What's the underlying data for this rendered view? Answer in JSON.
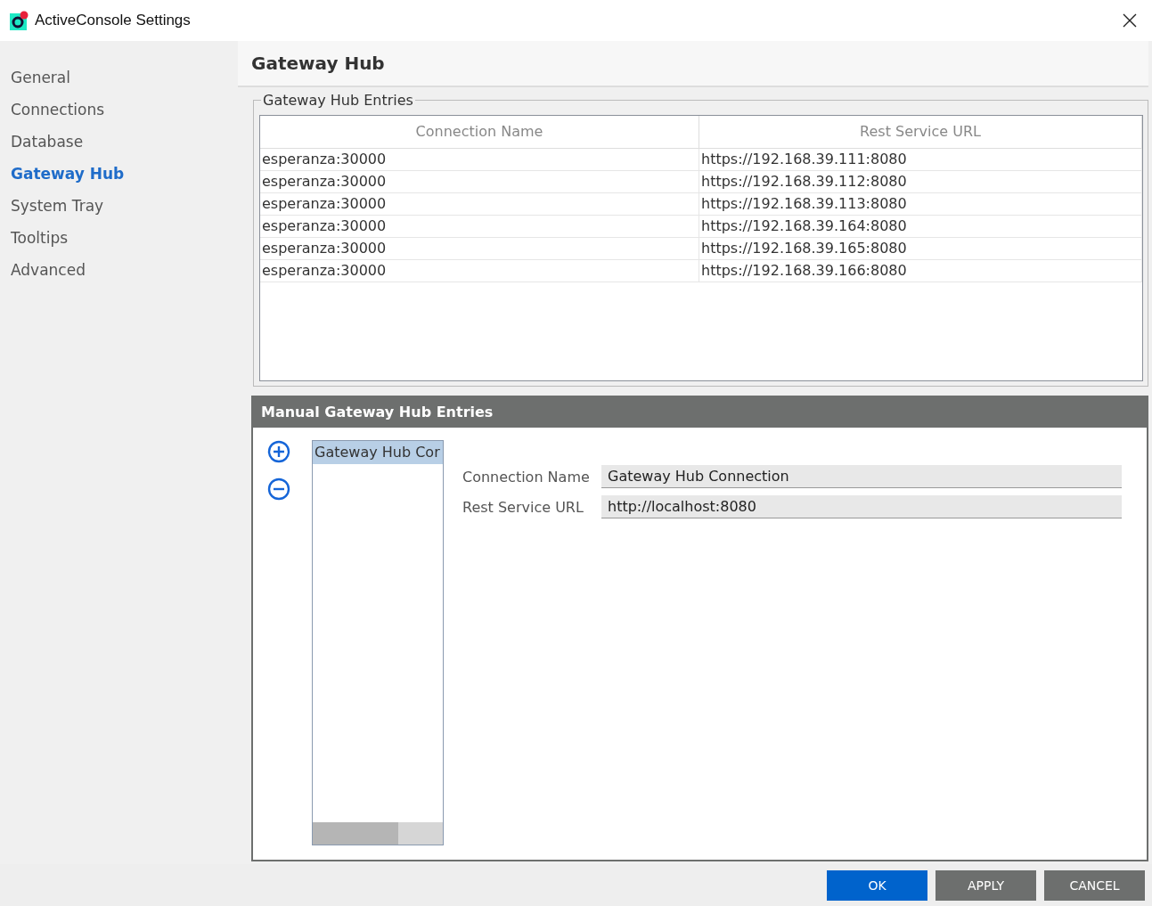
{
  "window": {
    "title": "ActiveConsole Settings"
  },
  "sidebar": {
    "items": [
      {
        "label": "General",
        "selected": false
      },
      {
        "label": "Connections",
        "selected": false
      },
      {
        "label": "Database",
        "selected": false
      },
      {
        "label": "Gateway Hub",
        "selected": true
      },
      {
        "label": "System Tray",
        "selected": false
      },
      {
        "label": "Tooltips",
        "selected": false
      },
      {
        "label": "Advanced",
        "selected": false
      }
    ]
  },
  "page_title": "Gateway Hub",
  "entries": {
    "title": "Gateway Hub Entries",
    "columns": [
      "Connection Name",
      "Rest Service URL"
    ],
    "rows": [
      [
        "esperanza:30000",
        "https://192.168.39.111:8080"
      ],
      [
        "esperanza:30000",
        "https://192.168.39.112:8080"
      ],
      [
        "esperanza:30000",
        "https://192.168.39.113:8080"
      ],
      [
        "esperanza:30000",
        "https://192.168.39.164:8080"
      ],
      [
        "esperanza:30000",
        "https://192.168.39.165:8080"
      ],
      [
        "esperanza:30000",
        "https://192.168.39.166:8080"
      ]
    ]
  },
  "manual": {
    "title": "Manual Gateway Hub Entries",
    "list": [
      {
        "label": "Gateway Hub Cor",
        "selected": true
      }
    ],
    "fields": [
      {
        "label": "Connection Name",
        "value": "Gateway Hub Connection"
      },
      {
        "label": "Rest Service URL",
        "value": "http://localhost:8080"
      }
    ]
  },
  "buttons": [
    {
      "label": "OK",
      "kind": "primary"
    },
    {
      "label": "APPLY",
      "kind": "secondary"
    },
    {
      "label": "CANCEL",
      "kind": "secondary"
    }
  ]
}
